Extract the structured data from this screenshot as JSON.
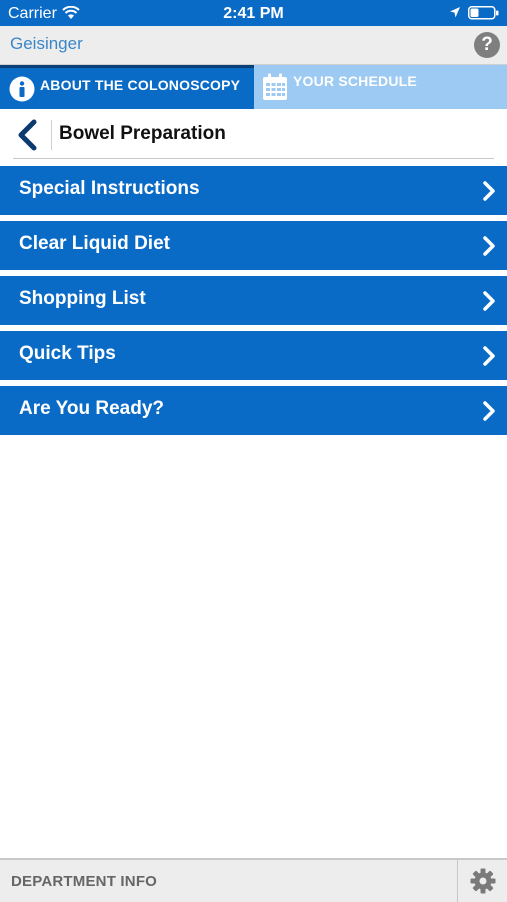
{
  "status_bar": {
    "carrier": "Carrier",
    "time": "2:41 PM"
  },
  "header": {
    "brand": "Geisinger",
    "help_label": "?"
  },
  "tabs": [
    {
      "label": "ABOUT THE COLONOSCOPY",
      "icon": "info-icon",
      "active": true
    },
    {
      "label": "YOUR SCHEDULE",
      "icon": "calendar-icon",
      "active": false
    }
  ],
  "section": {
    "title": "Bowel Preparation"
  },
  "menu": {
    "items": [
      {
        "label": "Special Instructions"
      },
      {
        "label": "Clear Liquid Diet"
      },
      {
        "label": "Shopping List"
      },
      {
        "label": "Quick Tips"
      },
      {
        "label": "Are You Ready?"
      }
    ]
  },
  "footer": {
    "department_label": "DEPARTMENT INFO"
  },
  "colors": {
    "primary": "#0a6bc7",
    "tab_inactive": "#9dcaf2",
    "header_bg": "#ededed"
  }
}
